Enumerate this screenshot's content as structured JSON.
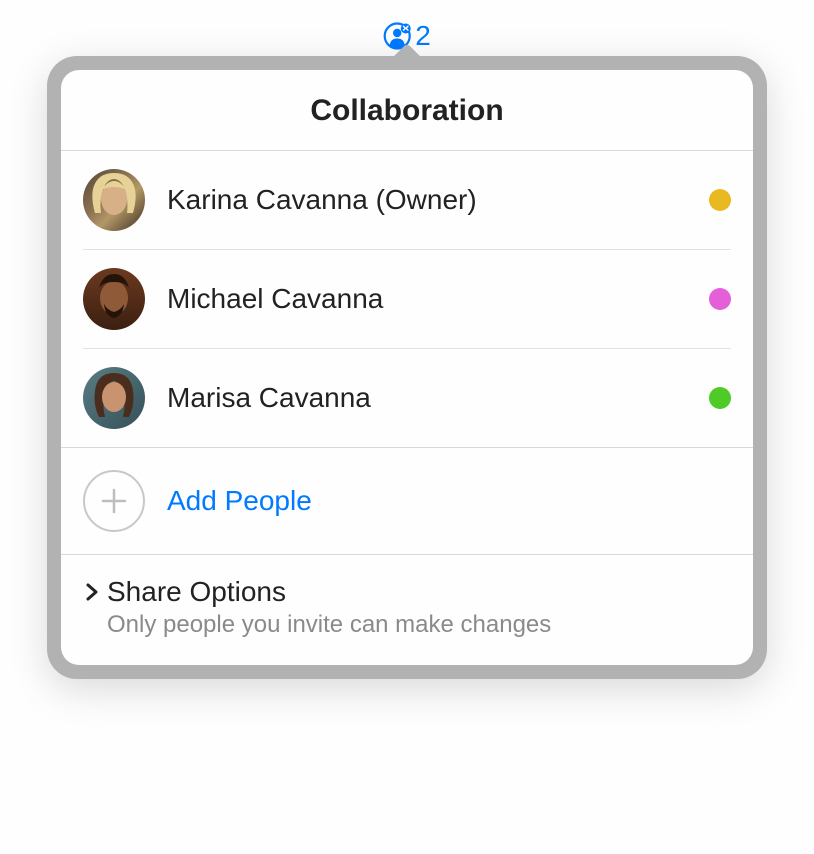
{
  "trigger": {
    "count": "2"
  },
  "popover": {
    "title": "Collaboration",
    "people": [
      {
        "name": "Karina Cavanna (Owner)",
        "color": "#e8b921"
      },
      {
        "name": "Michael Cavanna",
        "color": "#e55fd8"
      },
      {
        "name": "Marisa Cavanna",
        "color": "#4fcb27"
      }
    ],
    "addPeople": "Add People",
    "shareOptions": {
      "title": "Share Options",
      "subtitle": "Only people you invite can make changes"
    }
  }
}
